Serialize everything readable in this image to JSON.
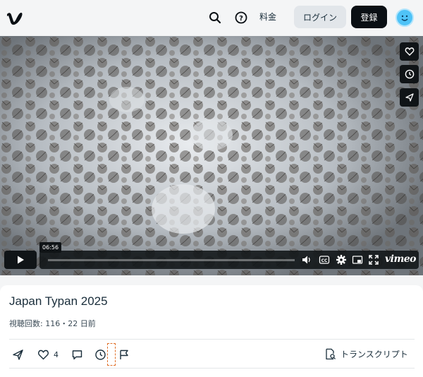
{
  "header": {
    "logo": "vimeo-v-logo",
    "search_icon": "search-icon",
    "help_icon": "help-circle-icon",
    "pricing_label": "料金",
    "login_label": "ログイン",
    "signup_label": "登録",
    "avatar_icon": "smiley-avatar-icon"
  },
  "player": {
    "side_actions": [
      "heart-icon",
      "clock-icon",
      "send-icon"
    ],
    "time_tooltip": "06:56",
    "progress": 0.0,
    "controls": [
      "volume-icon",
      "cc-icon",
      "settings-icon",
      "pip-icon",
      "fullscreen-icon"
    ],
    "brand": "vimeo"
  },
  "video": {
    "title": "Japan Typan 2025",
    "meta": "視聴回数: 116・22 日前",
    "like_count": "4",
    "transcript_label": "トランスクリプト"
  },
  "colors": {
    "accent": "#0a0f14",
    "avatar": "#4fc3f7",
    "marker": "#e0702a"
  }
}
